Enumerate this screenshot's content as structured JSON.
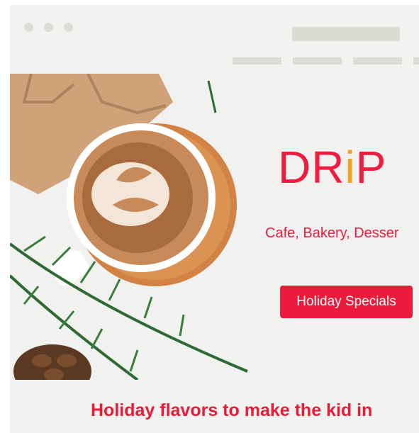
{
  "window": {
    "controls": [
      "dot-1",
      "dot-2",
      "dot-3"
    ]
  },
  "hero": {
    "brand_prefix": "DR",
    "brand_i": "i",
    "brand_suffix": "P",
    "tagline": "Cafe, Bakery, Desser",
    "cta_label": "Holiday Specials"
  },
  "headline": "Holiday flavors to make the kid in",
  "colors": {
    "brand_red": "#ee1c3e",
    "brand_orange": "#f2a11f",
    "placeholder_gray": "#dcdcd4",
    "page_bg": "#f2f2f0"
  },
  "icons": [
    "coffee-cup-icon",
    "pine-branch-icon",
    "pinecone-icon",
    "gift-box-icon"
  ]
}
